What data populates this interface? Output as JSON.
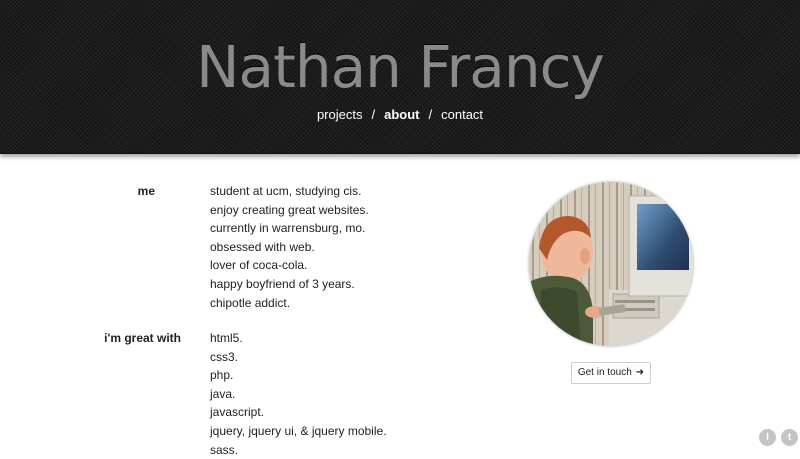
{
  "header": {
    "site_title": "Nathan Francy",
    "nav": [
      {
        "label": "projects"
      },
      {
        "label": "about",
        "active": true
      },
      {
        "label": "contact"
      }
    ],
    "separator": "/"
  },
  "about": {
    "me_label": "me",
    "me_items": [
      "student at ucm, studying cis.",
      "enjoy creating great websites.",
      "currently in warrensburg, mo.",
      "obsessed with web.",
      "lover of coca-cola.",
      "happy boyfriend of 3 years.",
      "chipotle addict."
    ],
    "skills_label": "i'm great with",
    "skills_items": [
      "html5.",
      "css3.",
      "php.",
      "java.",
      "javascript.",
      "jquery, jquery ui, & jquery mobile.",
      "sass."
    ]
  },
  "profile": {
    "cta_label": "Get in touch",
    "cta_icon": "arrow-right-icon"
  },
  "social": {
    "first_letter": "l",
    "second_letter": "t"
  },
  "colors": {
    "header_bg": "#1c1c1c",
    "title": "#8a8a8a",
    "nav_text": "#ffffff",
    "body_text": "#222222"
  }
}
